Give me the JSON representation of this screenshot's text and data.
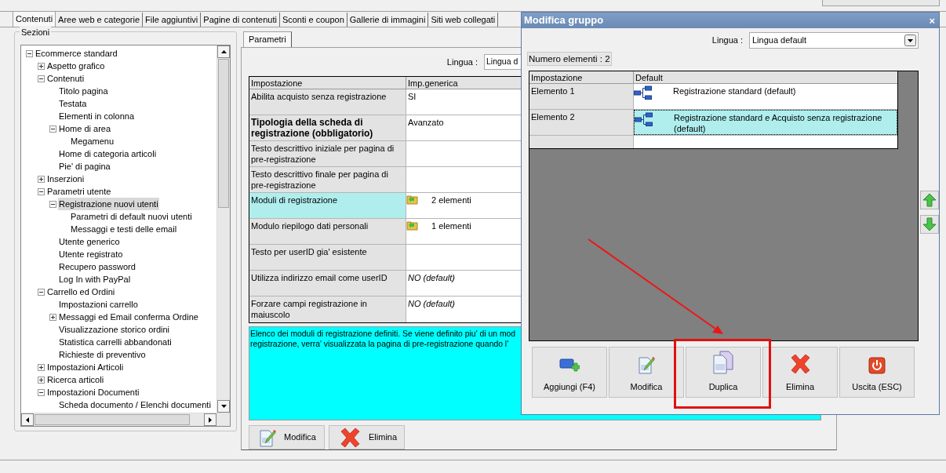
{
  "tabs": [
    {
      "label": "Contenuti",
      "selected": true
    },
    {
      "label": "Aree web e categorie",
      "selected": false
    },
    {
      "label": "File aggiuntivi",
      "selected": false
    },
    {
      "label": "Pagine di contenuti",
      "selected": false
    },
    {
      "label": "Sconti e coupon",
      "selected": false
    },
    {
      "label": "Gallerie di immagini",
      "selected": false
    },
    {
      "label": "Siti web collegati",
      "selected": false
    }
  ],
  "sections": {
    "title": "Sezioni",
    "tree": [
      {
        "label": "Ecommerce standard",
        "expanded": true,
        "selected": false,
        "children": [
          {
            "label": "Aspetto grafico",
            "expanded": false,
            "selected": false
          },
          {
            "label": "Contenuti",
            "expanded": true,
            "selected": false,
            "children": [
              {
                "label": "Titolo pagina",
                "selected": false
              },
              {
                "label": "Testata",
                "selected": false
              },
              {
                "label": "Elementi in colonna",
                "selected": false
              },
              {
                "label": "Home di area",
                "expanded": true,
                "selected": false,
                "children": [
                  {
                    "label": "Megamenu",
                    "selected": false
                  }
                ]
              },
              {
                "label": "Home di categoria articoli",
                "selected": false
              },
              {
                "label": "Pie' di pagina",
                "selected": false
              }
            ]
          },
          {
            "label": "Inserzioni",
            "expanded": false,
            "selected": false
          },
          {
            "label": "Parametri utente",
            "expanded": true,
            "selected": false,
            "children": [
              {
                "label": "Registrazione nuovi utenti",
                "expanded": true,
                "selected": true,
                "children": [
                  {
                    "label": "Parametri di default nuovi utenti",
                    "selected": false
                  },
                  {
                    "label": "Messaggi e testi delle email",
                    "selected": false
                  }
                ]
              },
              {
                "label": "Utente generico",
                "selected": false
              },
              {
                "label": "Utente registrato",
                "selected": false
              },
              {
                "label": "Recupero password",
                "selected": false
              },
              {
                "label": "Log In with PayPal",
                "selected": false
              }
            ]
          },
          {
            "label": "Carrello ed Ordini",
            "expanded": true,
            "selected": false,
            "children": [
              {
                "label": "Impostazioni carrello",
                "selected": false
              },
              {
                "label": "Messaggi ed Email conferma Ordine",
                "expanded": false,
                "selected": false
              },
              {
                "label": "Visualizzazione storico ordini",
                "selected": false
              },
              {
                "label": "Statistica carrelli abbandonati",
                "selected": false
              },
              {
                "label": "Richieste di preventivo",
                "selected": false
              }
            ]
          },
          {
            "label": "Impostazioni Articoli",
            "expanded": false,
            "selected": false
          },
          {
            "label": "Ricerca articoli",
            "expanded": false,
            "selected": false
          },
          {
            "label": "Impostazioni Documenti",
            "expanded": true,
            "selected": false,
            "children": [
              {
                "label": "Scheda documento / Elenchi documenti",
                "selected": false
              }
            ]
          }
        ]
      }
    ]
  },
  "params_tab": {
    "label": "Parametri",
    "selected": true
  },
  "language": {
    "label": "Lingua :",
    "value": "Lingua d"
  },
  "table": {
    "columns": [
      "Impostazione",
      "Imp.generica"
    ],
    "rows": [
      {
        "setting": "Abilita acquisto senza registrazione",
        "value": "SI",
        "kind": "text",
        "bold": false,
        "selected": false
      },
      {
        "setting": "Tipologia della scheda di registrazione (obbligatorio)",
        "value": "Avanzato",
        "kind": "text",
        "bold": true,
        "selected": false
      },
      {
        "setting": "Testo descrittivo iniziale per pagina di pre-registrazione",
        "kind": "empty",
        "bold": false,
        "selected": false
      },
      {
        "setting": "Testo descrittivo finale per pagina di pre-registrazione",
        "kind": "empty",
        "bold": false,
        "selected": false
      },
      {
        "setting": "Moduli di registrazione",
        "value": "2 elementi",
        "kind": "group",
        "bold": false,
        "selected": true
      },
      {
        "setting": "Modulo riepilogo dati personali",
        "value": "1 elementi",
        "kind": "group",
        "bold": false,
        "selected": false
      },
      {
        "setting": "Testo per userID gia' esistente",
        "kind": "empty",
        "bold": false,
        "selected": false
      },
      {
        "setting": "Utilizza indirizzo email come userID",
        "value": "NO (default)",
        "kind": "default",
        "bold": false,
        "selected": false
      },
      {
        "setting": "Forzare campi registrazione in maiuscolo",
        "value": "NO (default)",
        "kind": "default",
        "bold": false,
        "selected": false
      }
    ]
  },
  "description": [
    "Elenco dei moduli di registrazione definiti. Se viene definito piu' di un mod",
    "registrazione, verra' visualizzata la pagina di pre-registrazione quando l'"
  ],
  "buttons": [
    {
      "label": "Modifica",
      "kind": "edit"
    },
    {
      "label": "Elimina",
      "kind": "delete"
    }
  ],
  "dialog": {
    "title": "Modifica gruppo",
    "close": "×",
    "language": {
      "label": "Lingua :",
      "value": "Lingua default"
    },
    "count": "Numero elementi : 2",
    "table": {
      "columns": [
        "Impostazione",
        "Default"
      ],
      "rows": [
        {
          "setting": "Elemento 1",
          "value": "Registrazione standard (default)",
          "selected": false
        },
        {
          "setting": "Elemento 2",
          "value": "Registrazione standard e Acquisto senza registrazione (default)",
          "selected": true
        }
      ]
    },
    "buttons": [
      {
        "label": "Aggiungi (F4)",
        "kind": "add",
        "highlighted": false
      },
      {
        "label": "Modifica",
        "kind": "edit",
        "highlighted": false
      },
      {
        "label": "Duplica",
        "kind": "duplicate",
        "highlighted": true
      },
      {
        "label": "Elimina",
        "kind": "delete",
        "highlighted": false
      },
      {
        "label": "Uscita (ESC)",
        "kind": "exit",
        "highlighted": false
      }
    ]
  }
}
